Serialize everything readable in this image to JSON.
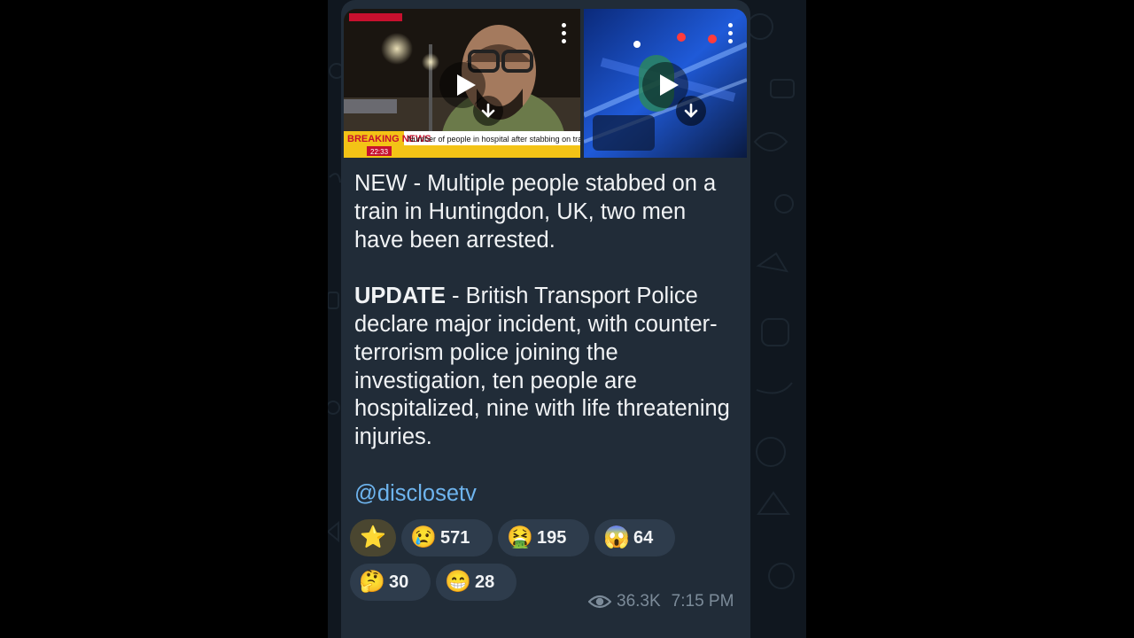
{
  "post": {
    "videos": [
      {
        "ticker_label": "BREAKING NEWS",
        "ticker_text": "Number of people in hospital after stabbing on train",
        "time": "22:33"
      },
      {}
    ],
    "text_para1": "NEW - Multiple people stabbed on a train in Huntingdon, UK, two men have been arrested.",
    "update_label": "UPDATE",
    "text_para2": " - British Transport Police declare major incident, with counter-terrorism police joining the investigation, ten people are hospitalized, nine with life threatening injuries.",
    "channel": "@disclosetv",
    "reactions": [
      {
        "emoji": "⭐",
        "count": ""
      },
      {
        "emoji": "😢",
        "count": "571"
      },
      {
        "emoji": "🤮",
        "count": "195"
      },
      {
        "emoji": "😱",
        "count": "64"
      },
      {
        "emoji": "🤔",
        "count": "30"
      },
      {
        "emoji": "😁",
        "count": "28"
      }
    ],
    "views": "36.3K",
    "time": "7:15 PM"
  },
  "colors": {
    "bubble": "#212c38",
    "link": "#6eb4ee",
    "reaction_bg": "#2e3c4c",
    "meta": "#7c8b99",
    "news_yellow": "#f3c316",
    "news_red": "#c8102e"
  },
  "icons": [
    "play-icon",
    "download-icon",
    "more-vert-icon",
    "eye-icon"
  ]
}
